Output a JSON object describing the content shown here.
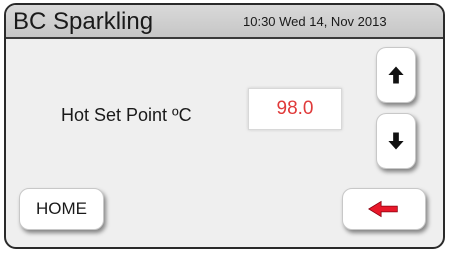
{
  "header": {
    "title": "BC Sparkling",
    "datetime": "10:30 Wed 14, Nov 2013"
  },
  "setpoint": {
    "label": "Hot Set Point ºC",
    "value": "98.0"
  },
  "buttons": {
    "up_icon": "arrow-up-icon",
    "down_icon": "arrow-down-icon",
    "home_label": "HOME",
    "back_icon": "arrow-left-icon"
  },
  "colors": {
    "value_text": "#e03a3a",
    "back_arrow": "#e8182a",
    "title_bar": "#c6c6c6"
  }
}
